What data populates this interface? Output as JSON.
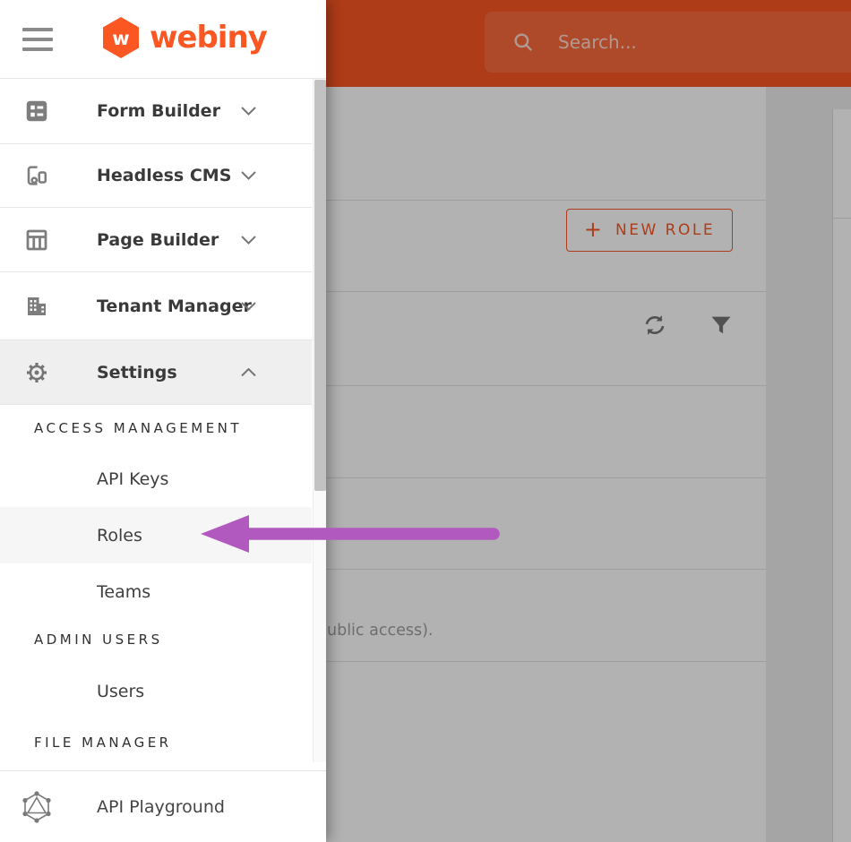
{
  "sidebar": {
    "brand": "webiny",
    "items": [
      {
        "label": "Form Builder",
        "icon": "form-builder-icon",
        "state": "collapsed"
      },
      {
        "label": "Headless CMS",
        "icon": "headless-cms-icon",
        "state": "collapsed"
      },
      {
        "label": "Page Builder",
        "icon": "page-builder-icon",
        "state": "collapsed"
      },
      {
        "label": "Tenant Manager",
        "icon": "tenant-manager-icon",
        "state": "collapsed"
      },
      {
        "label": "Settings",
        "icon": "settings-gear-icon",
        "state": "expanded"
      }
    ],
    "settings_sections": [
      {
        "title": "ACCESS MANAGEMENT",
        "items": [
          {
            "label": "API Keys"
          },
          {
            "label": "Roles",
            "highlighted": true
          },
          {
            "label": "Teams"
          }
        ]
      },
      {
        "title": "ADMIN USERS",
        "items": [
          {
            "label": "Users"
          }
        ]
      },
      {
        "title": "FILE MANAGER",
        "items": []
      }
    ],
    "bottom_item": {
      "label": "API Playground",
      "icon": "graphql-icon"
    }
  },
  "topbar": {
    "search_placeholder": "Search...",
    "search_icon": "search-icon",
    "menu_icon": "hamburger-menu-icon"
  },
  "content": {
    "new_role_button": {
      "plus": "+",
      "label": "NEW ROLE"
    },
    "toolbar_icons": [
      "refresh-icon",
      "filter-icon"
    ],
    "visible_list_fragment": "ublic access)."
  },
  "annotation": {
    "type": "arrow-left",
    "points_at": "Roles",
    "color": "#b159be"
  },
  "colors": {
    "accent_orange": "#fa5723",
    "scrim": "rgba(0,0,0,0.30)",
    "arrow_purple": "#b159be",
    "sidebar_icon_gray": "#7d7d7d"
  }
}
